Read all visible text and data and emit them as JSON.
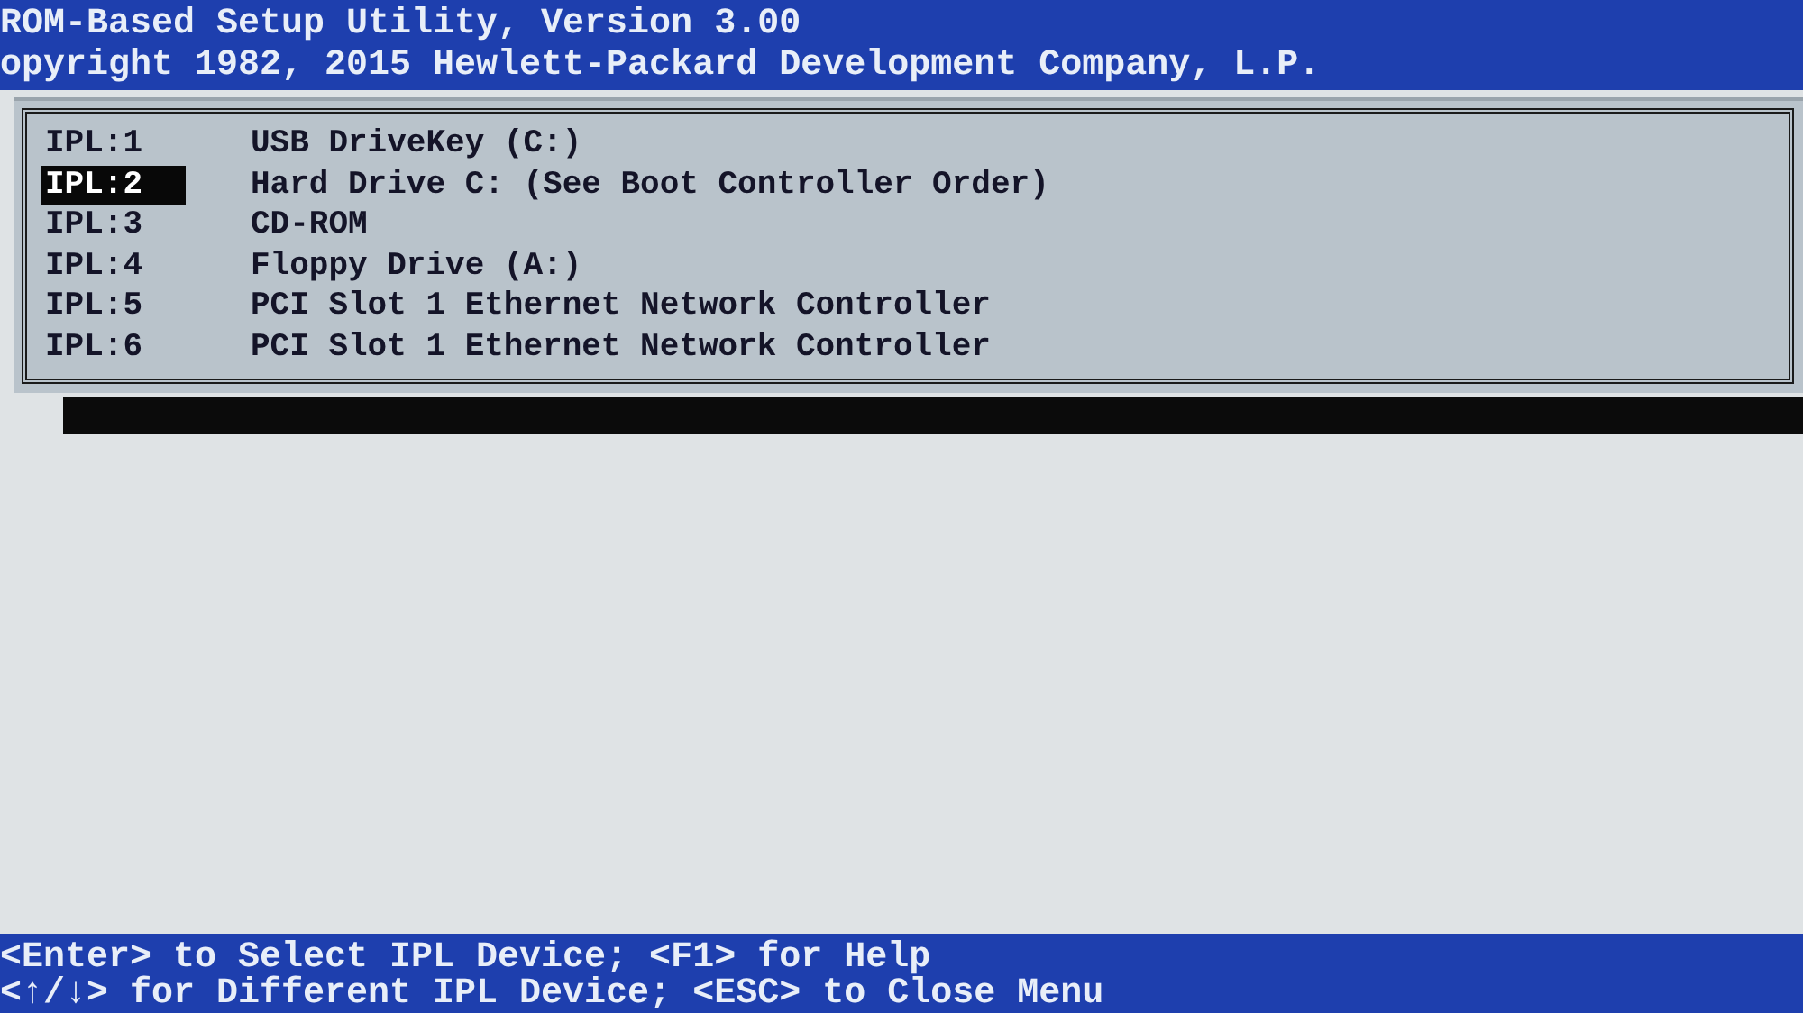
{
  "header": {
    "title": "ROM-Based Setup Utility, Version 3.00",
    "copyright": "opyright 1982, 2015 Hewlett-Packard Development Company, L.P."
  },
  "ipl_devices": [
    {
      "label": "IPL:1",
      "device": "USB DriveKey (C:)",
      "selected": false
    },
    {
      "label": "IPL:2",
      "device": "Hard Drive C: (See Boot Controller Order)",
      "selected": true
    },
    {
      "label": "IPL:3",
      "device": "CD-ROM",
      "selected": false
    },
    {
      "label": "IPL:4",
      "device": "Floppy Drive (A:)",
      "selected": false
    },
    {
      "label": "IPL:5",
      "device": "PCI Slot 1 Ethernet Network Controller",
      "selected": false
    },
    {
      "label": "IPL:6",
      "device": "PCI Slot 1 Ethernet Network Controller",
      "selected": false
    }
  ],
  "help_lines": [
    "<Enter> to Select IPL Device; <F1> for Help",
    "<↑/↓> for Different IPL Device; <ESC> to Close Menu"
  ]
}
